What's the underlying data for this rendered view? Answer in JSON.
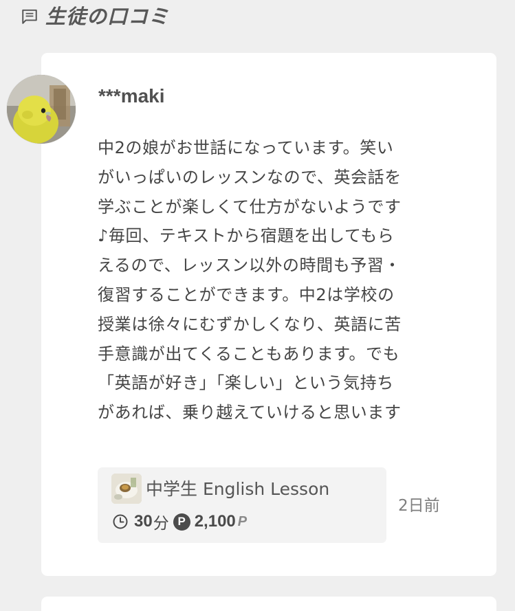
{
  "section": {
    "icon": "comment-icon",
    "title": "生徒の口コミ"
  },
  "review": {
    "avatar": "parakeet-avatar",
    "username": "***maki",
    "body_lines": [
      "中2の娘がお世話になっています。笑い",
      "がいっぱいのレッスンなので、英会話を",
      "学ぶことが楽しくて仕方がないようです",
      "♪毎回、テキストから宿題を出してもら",
      "えるので、レッスン以外の時間も予習・",
      "復習することができます。中2は学校の",
      "授業は徐々にむずかしくなり、英語に苦",
      "手意識が出てくることもあります。でも",
      "「英語が好き」「楽しい」という気持ち",
      "があれば、乗り越えていけると思います",
      "^ ^"
    ],
    "lesson": {
      "thumbnail": "lesson-thumbnail",
      "title": "中学生 English Lesson",
      "duration": "30",
      "duration_unit": "分",
      "points_icon": "P",
      "price": "2,100",
      "price_unit": "P"
    },
    "posted": "2日前"
  },
  "colors": {
    "background": "#efefef",
    "card": "#ffffff",
    "lesson_box": "#f3f3f3",
    "text": "#454545"
  }
}
